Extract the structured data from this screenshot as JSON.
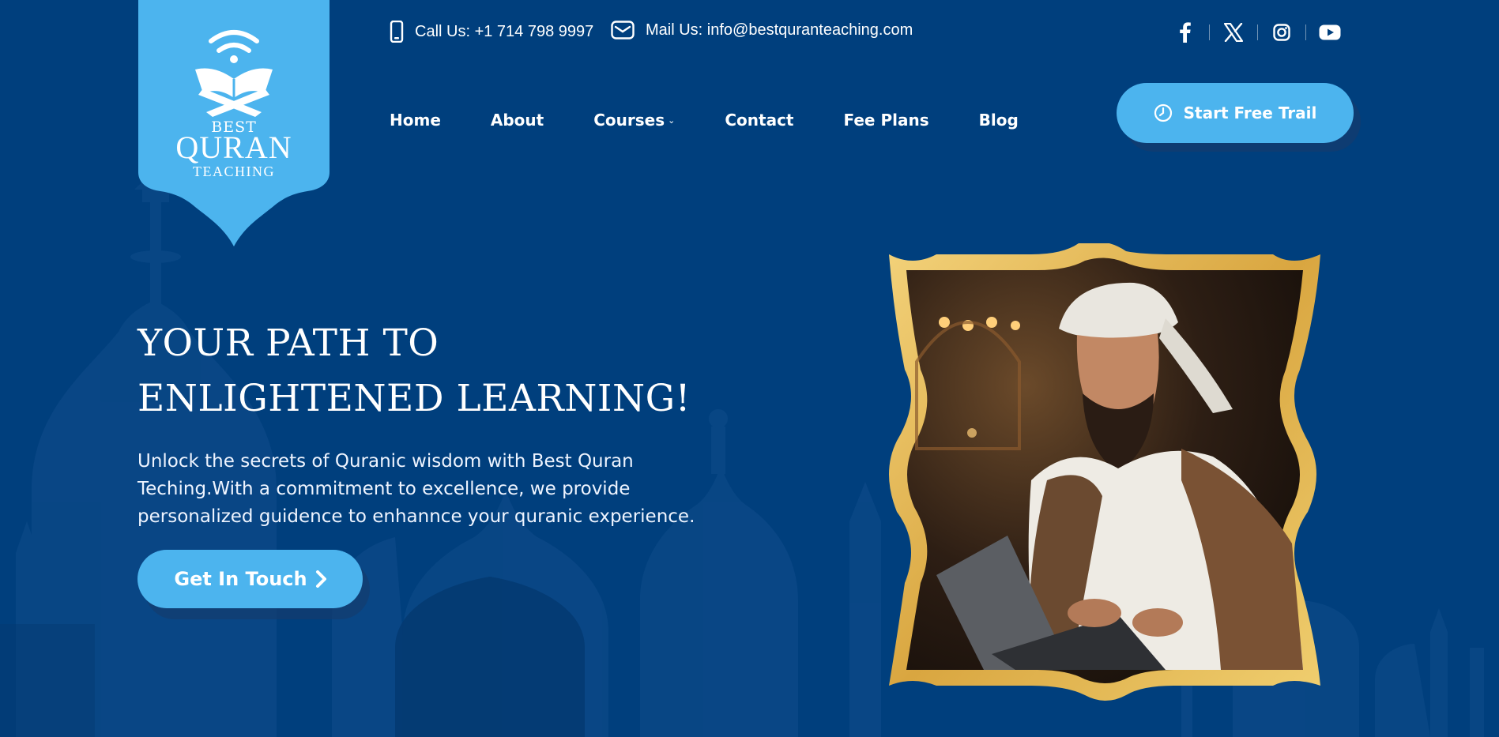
{
  "brand": {
    "logo_top": "BEST",
    "logo_main": "QURAN",
    "logo_bottom": "TEACHING",
    "colors": {
      "background": "#003f7d",
      "accent": "#4cb4ee",
      "frame_gold": "#e8b84a"
    }
  },
  "contact": {
    "phone_icon": "mobile-phone-icon",
    "phone": "Call Us: +1 714 798 9997",
    "mail_icon": "envelope-icon",
    "mail": "Mail Us: info@bestquranteaching.com"
  },
  "social": {
    "icons": [
      "facebook-icon",
      "x-twitter-icon",
      "instagram-icon",
      "youtube-icon"
    ]
  },
  "nav": {
    "items": [
      {
        "label": "Home"
      },
      {
        "label": "About"
      },
      {
        "label": "Courses",
        "dropdown": true
      },
      {
        "label": "Contact"
      },
      {
        "label": "Fee Plans"
      },
      {
        "label": "Blog"
      }
    ],
    "cta_label": "Start Free Trail",
    "cta_icon": "clock-icon"
  },
  "hero": {
    "title_line1": "YOUR PATH TO",
    "title_line2": "ENLIGHTENED LEARNING!",
    "description": "Unlock the secrets of Quranic wisdom with Best Quran Teching.With a commitment to excellence, we provide personalized guidence to enhannce your quranic experience.",
    "button_label": "Get In Touch",
    "button_icon": "chevron-right-icon"
  }
}
